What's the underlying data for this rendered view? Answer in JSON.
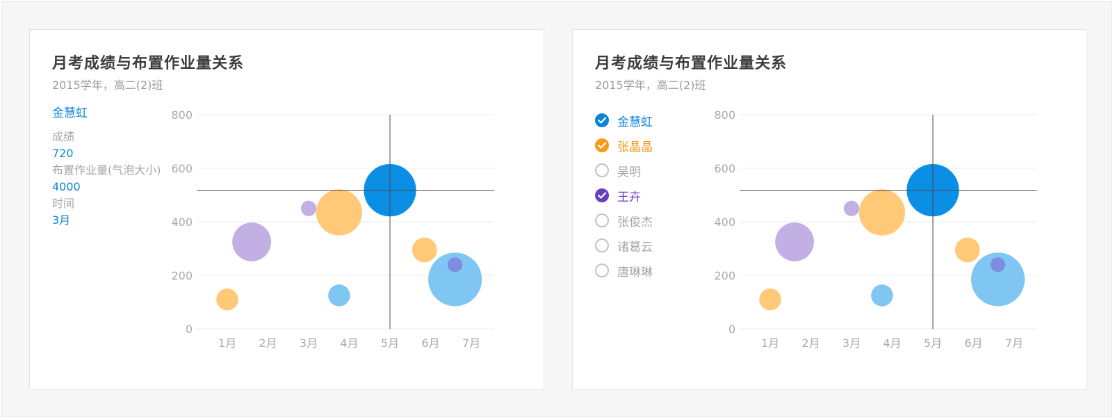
{
  "cards": [
    {
      "title": "月考成绩与布置作业量关系",
      "subtitle": "2015学年，高二(2)班"
    },
    {
      "title": "月考成绩与布置作业量关系",
      "subtitle": "2015学年，高二(2)班"
    }
  ],
  "tooltip": {
    "name": "金慧虹",
    "score_label": "成绩",
    "score_value": "720",
    "homework_label": "布置作业量(气泡大小)",
    "homework_value": "4000",
    "time_label": "时间",
    "time_value": "3月"
  },
  "legend": [
    {
      "name": "金慧虹",
      "checked": true,
      "color": "#0b84d8"
    },
    {
      "name": "张晶晶",
      "checked": true,
      "color": "#f59a1b"
    },
    {
      "name": "吴明",
      "checked": false,
      "color": "#a6a6a6"
    },
    {
      "name": "王卉",
      "checked": true,
      "color": "#6a3fbf"
    },
    {
      "name": "张俊杰",
      "checked": false,
      "color": "#a6a6a6"
    },
    {
      "name": "诸葛云",
      "checked": false,
      "color": "#a6a6a6"
    },
    {
      "name": "唐琳琳",
      "checked": false,
      "color": "#a6a6a6"
    }
  ],
  "colors": {
    "blue": "#0a8fe4",
    "light_blue": "#7fc6f2",
    "orange": "#ffc978",
    "purple": "#c2afe3",
    "mid_purple": "#7f8de0",
    "crosshair": "#4a4a4a",
    "grid": "#ebebeb"
  },
  "chart_data": [
    {
      "type": "scatter",
      "categories": [
        "1月",
        "2月",
        "3月",
        "4月",
        "5月",
        "6月",
        "7月"
      ],
      "y_ticks": [
        0,
        200,
        400,
        600,
        800
      ],
      "ylim": [
        0,
        800
      ],
      "crosshair": {
        "x": 5.0,
        "y": 518
      },
      "points": [
        {
          "x": 1.0,
          "y": 110,
          "size": 700,
          "color": "orange"
        },
        {
          "x": 1.6,
          "y": 325,
          "size": 2200,
          "color": "purple"
        },
        {
          "x": 3.0,
          "y": 450,
          "size": 350,
          "color": "purple"
        },
        {
          "x": 3.75,
          "y": 435,
          "size": 3100,
          "color": "orange"
        },
        {
          "x": 3.75,
          "y": 125,
          "size": 700,
          "color": "light_blue"
        },
        {
          "x": 5.0,
          "y": 518,
          "size": 4000,
          "color": "blue"
        },
        {
          "x": 5.85,
          "y": 295,
          "size": 900,
          "color": "orange"
        },
        {
          "x": 6.6,
          "y": 185,
          "size": 4200,
          "color": "light_blue"
        },
        {
          "x": 6.6,
          "y": 240,
          "size": 320,
          "color": "mid_purple"
        }
      ]
    },
    {
      "type": "scatter",
      "categories": [
        "1月",
        "2月",
        "3月",
        "4月",
        "5月",
        "6月",
        "7月"
      ],
      "y_ticks": [
        0,
        200,
        400,
        600,
        800
      ],
      "ylim": [
        0,
        800
      ],
      "crosshair": {
        "x": 5.0,
        "y": 518
      },
      "points": [
        {
          "x": 1.0,
          "y": 110,
          "size": 700,
          "color": "orange"
        },
        {
          "x": 1.6,
          "y": 325,
          "size": 2200,
          "color": "purple"
        },
        {
          "x": 3.0,
          "y": 450,
          "size": 350,
          "color": "purple"
        },
        {
          "x": 3.75,
          "y": 435,
          "size": 3100,
          "color": "orange"
        },
        {
          "x": 3.75,
          "y": 125,
          "size": 700,
          "color": "light_blue"
        },
        {
          "x": 5.0,
          "y": 518,
          "size": 4000,
          "color": "blue"
        },
        {
          "x": 5.85,
          "y": 295,
          "size": 900,
          "color": "orange"
        },
        {
          "x": 6.6,
          "y": 185,
          "size": 4200,
          "color": "light_blue"
        },
        {
          "x": 6.6,
          "y": 240,
          "size": 320,
          "color": "mid_purple"
        }
      ]
    }
  ]
}
